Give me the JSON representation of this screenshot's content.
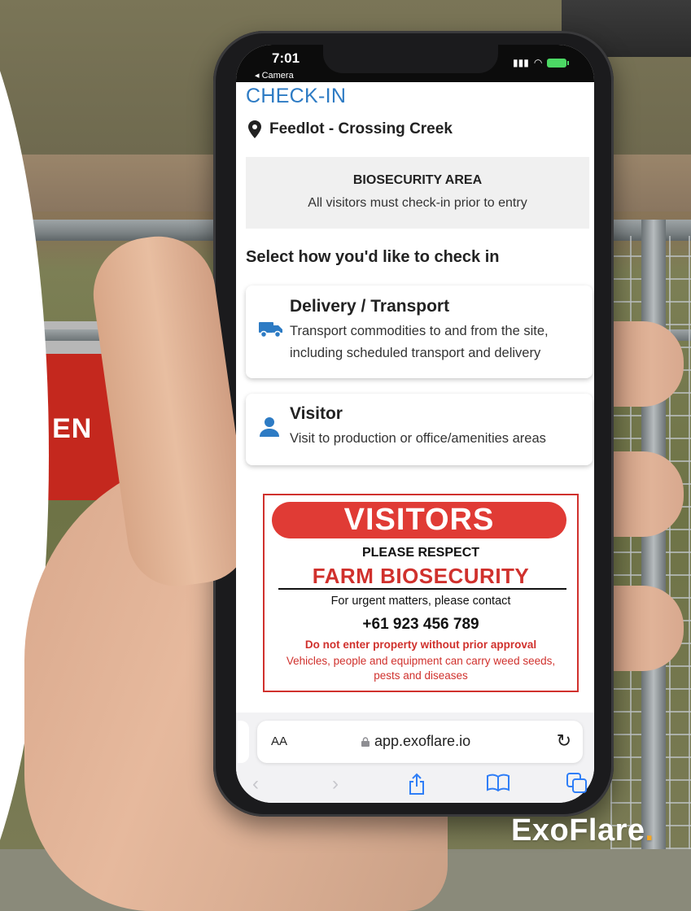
{
  "status_bar": {
    "time": "7:01",
    "back_label": "◂ Camera"
  },
  "page": {
    "title": "CHECK-IN",
    "location": "Feedlot - Crossing Creek",
    "biosecurity": {
      "title": "BIOSECURITY AREA",
      "subtitle": "All visitors must check-in prior to entry"
    },
    "select_heading": "Select how you'd like to check in",
    "options": [
      {
        "title": "Delivery / Transport",
        "description": "Transport commodities to and from the site, including scheduled transport and delivery",
        "icon": "truck-icon"
      },
      {
        "title": "Visitor",
        "description": "Visit to production or office/amenities areas",
        "icon": "person-icon"
      }
    ]
  },
  "sign": {
    "banner": "VISITORS",
    "respect": "PLEASE RESPECT",
    "farm": "FARM BIOSECURITY",
    "urgent": "For urgent matters, please contact",
    "phone": "+61 923 456 789",
    "no_enter": "Do not enter property without prior approval",
    "vehicles": "Vehicles, people and equipment can carry weed seeds, pests and diseases"
  },
  "browser": {
    "text_size_label": "AA",
    "url": "app.exoflare.io",
    "reload_icon": "reload-icon"
  },
  "background_sign_text": "E EN",
  "brand": {
    "name": "ExoFlare",
    "dot": "."
  },
  "colors": {
    "accent_blue": "#2d7bc4",
    "sign_red": "#d0312d",
    "safari_blue": "#2f7ef7"
  }
}
